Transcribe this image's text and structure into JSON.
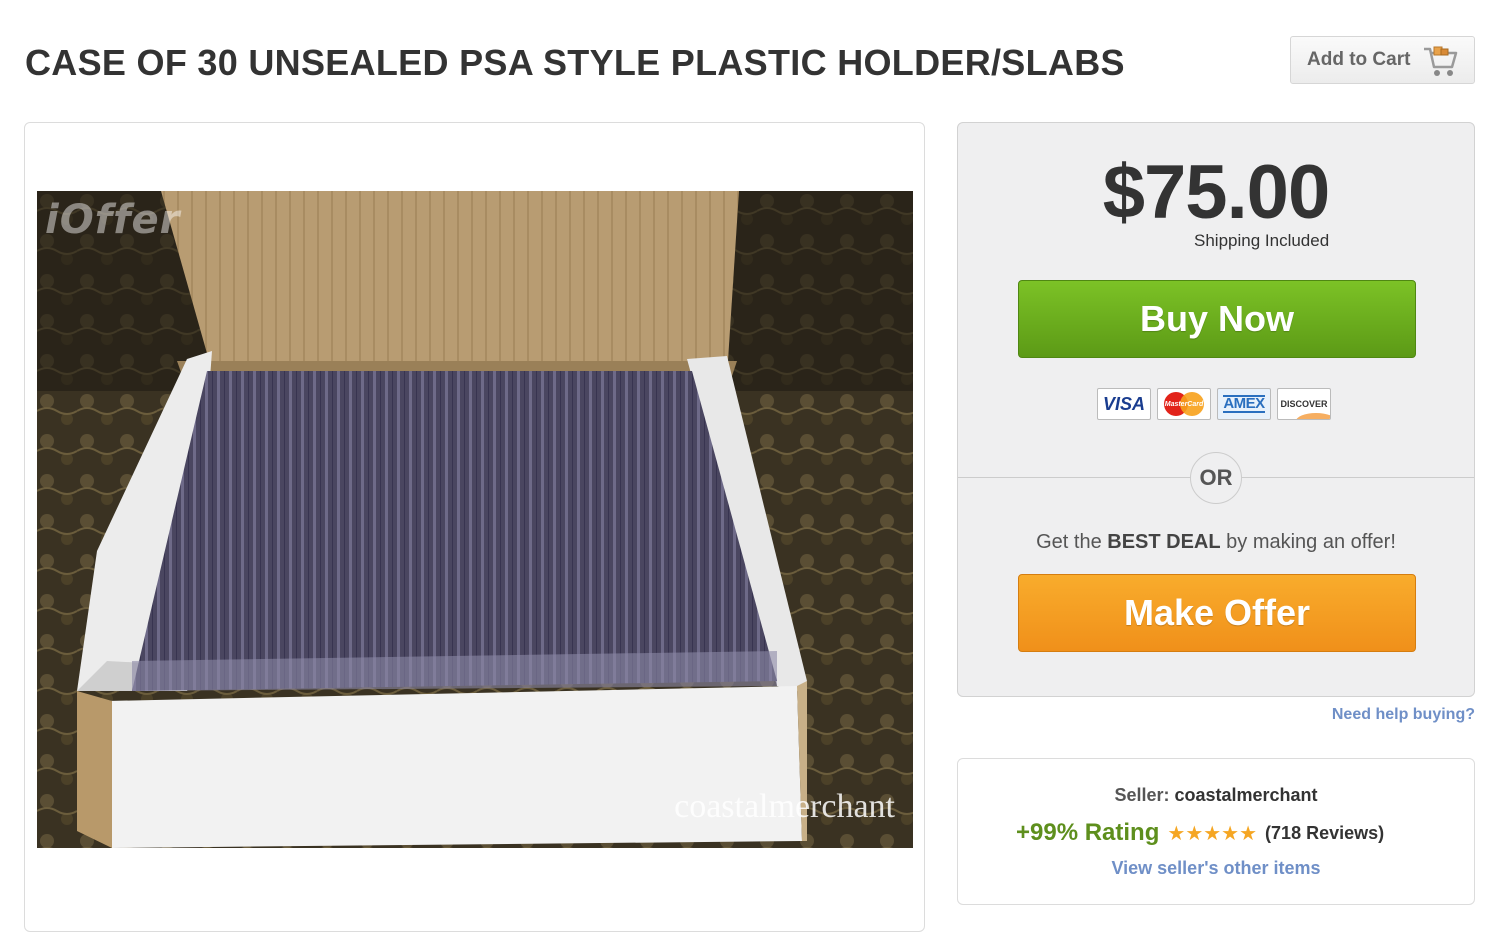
{
  "listing": {
    "title": "CASE OF 30 UNSEALED PSA STYLE PLASTIC HOLDER/SLABS",
    "add_to_cart_label": "Add to Cart",
    "image": {
      "description_alt": "Open cardboard box containing plastic card holder slabs",
      "watermark_top": "iOffer",
      "watermark_bottom": "coastalmerchant"
    }
  },
  "purchase": {
    "price": "$75.00",
    "shipping": "Shipping Included",
    "buy_now_label": "Buy Now",
    "payment_cards": [
      "VISA",
      "MasterCard",
      "AMEX",
      "DISCOVER"
    ],
    "or_label": "OR",
    "deal_prefix": "Get the ",
    "deal_bold": "BEST DEAL",
    "deal_suffix": " by making an offer!",
    "make_offer_label": "Make Offer",
    "help_link": "Need help buying?"
  },
  "seller": {
    "label": "Seller: ",
    "name": "coastalmerchant",
    "rating": "+99% Rating",
    "stars": "★★★★★",
    "reviews": "(718 Reviews)",
    "other_items_link": "View seller's other items"
  },
  "colors": {
    "buy_now": "#6aaa1e",
    "make_offer": "#f4a023",
    "link": "#6f8fc7",
    "rating_green": "#5e8f1d"
  }
}
